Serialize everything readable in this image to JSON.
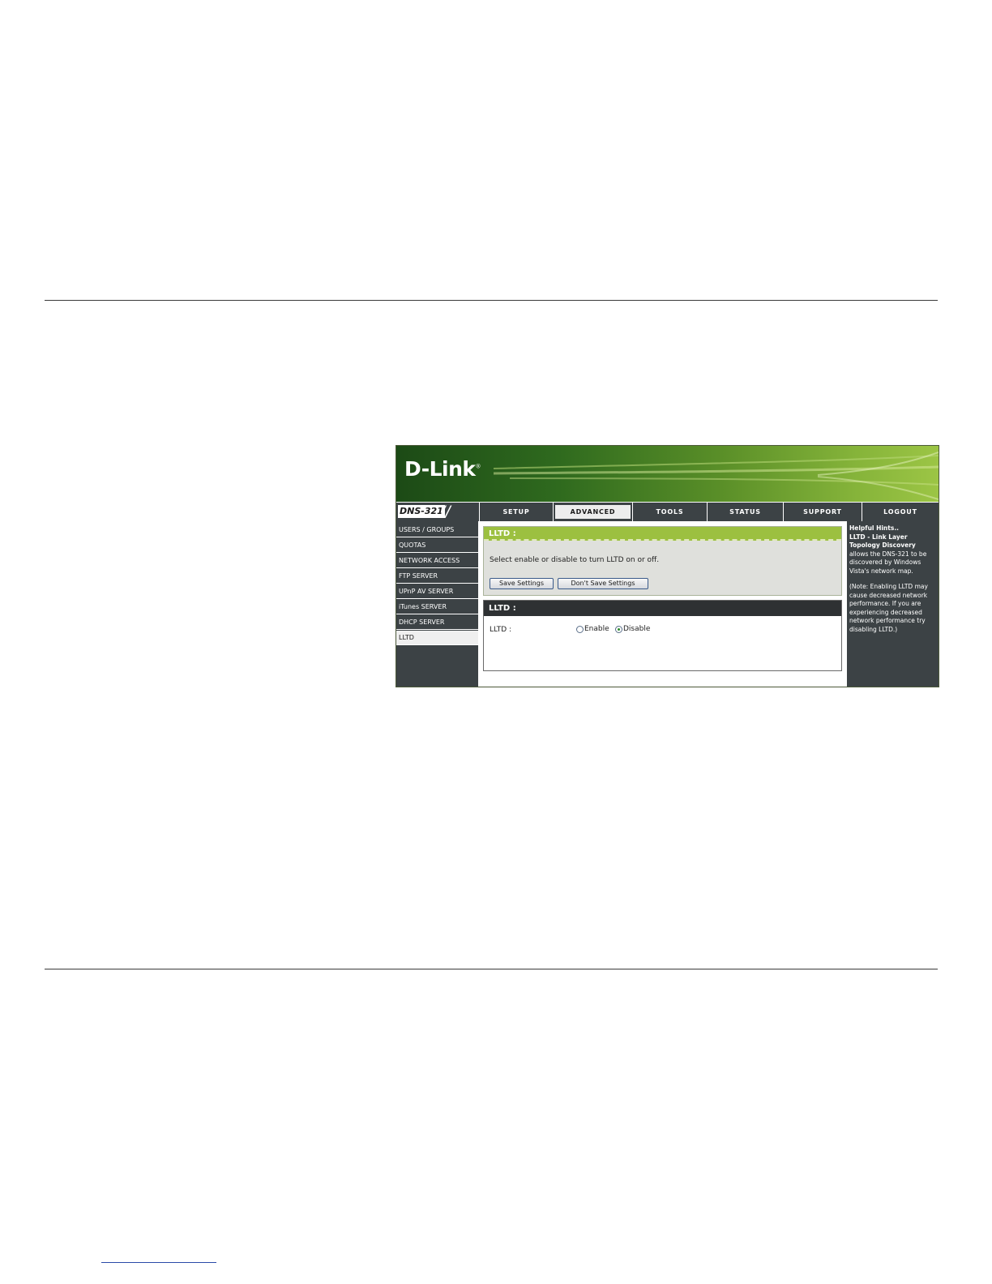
{
  "brand": {
    "logo": "D-Link",
    "reg": "®",
    "model": "DNS-321"
  },
  "tabs": [
    "SETUP",
    "ADVANCED",
    "TOOLS",
    "STATUS",
    "SUPPORT",
    "LOGOUT"
  ],
  "active_tab": "ADVANCED",
  "sidebar": {
    "items": [
      "USERS / GROUPS",
      "QUOTAS",
      "NETWORK ACCESS",
      "FTP SERVER",
      "UPnP AV SERVER",
      "iTunes SERVER",
      "DHCP SERVER",
      "LLTD"
    ],
    "active": "LLTD"
  },
  "panel1": {
    "title": "LLTD :",
    "description": "Select enable or disable to turn LLTD on or off.",
    "save_label": "Save Settings",
    "dont_save_label": "Don't Save Settings"
  },
  "panel2": {
    "title": "LLTD :",
    "field_label": "LLTD :",
    "enable_label": "Enable",
    "disable_label": "Disable",
    "selected": "Disable"
  },
  "hints": {
    "heading": "Helpful Hints..",
    "subheading": "LLTD - Link Layer Topology Discovery",
    "body": "allows the DNS-321 to be discovered by Windows Vista's network map.",
    "note": "(Note: Enabling LLTD may cause decreased network performance. If you are experiencing decreased network performance try disabling LLTD.)"
  }
}
